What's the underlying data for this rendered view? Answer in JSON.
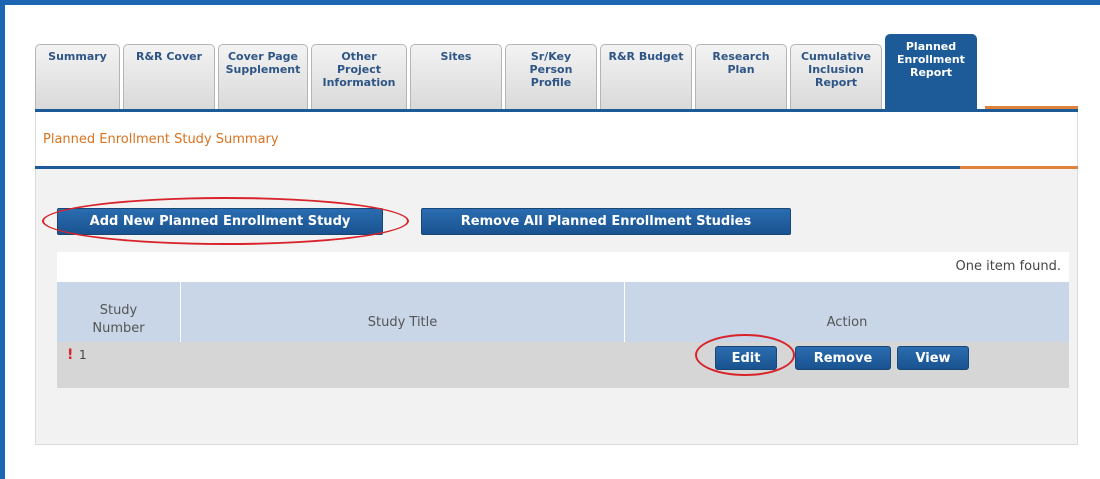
{
  "tabs": [
    {
      "label": "Summary",
      "active": false
    },
    {
      "label": "R&R Cover",
      "active": false
    },
    {
      "label": "Cover Page\nSupplement",
      "active": false
    },
    {
      "label": "Other\nProject\nInformation",
      "active": false
    },
    {
      "label": "Sites",
      "active": false
    },
    {
      "label": "Sr/Key\nPerson\nProfile",
      "active": false
    },
    {
      "label": "R&R Budget",
      "active": false
    },
    {
      "label": "Research\nPlan",
      "active": false
    },
    {
      "label": "Cumulative\nInclusion\nReport",
      "active": false
    },
    {
      "label": "Planned\nEnrollment\nReport",
      "active": true
    }
  ],
  "section": {
    "title": "Planned Enrollment Study Summary"
  },
  "actions": {
    "add_label": "Add New Planned Enrollment Study",
    "remove_all_label": "Remove All Planned Enrollment Studies"
  },
  "table": {
    "count_text": "One item found.",
    "headers": {
      "number": "Study\nNumber",
      "title": "Study Title",
      "action": "Action"
    },
    "rows": [
      {
        "warning": "!",
        "number": "1",
        "title": "",
        "edit": "Edit",
        "remove": "Remove",
        "view": "View"
      }
    ]
  },
  "colors": {
    "accent_blue": "#1d5b98",
    "accent_orange": "#e0823c",
    "highlight_red": "#d8232a"
  }
}
